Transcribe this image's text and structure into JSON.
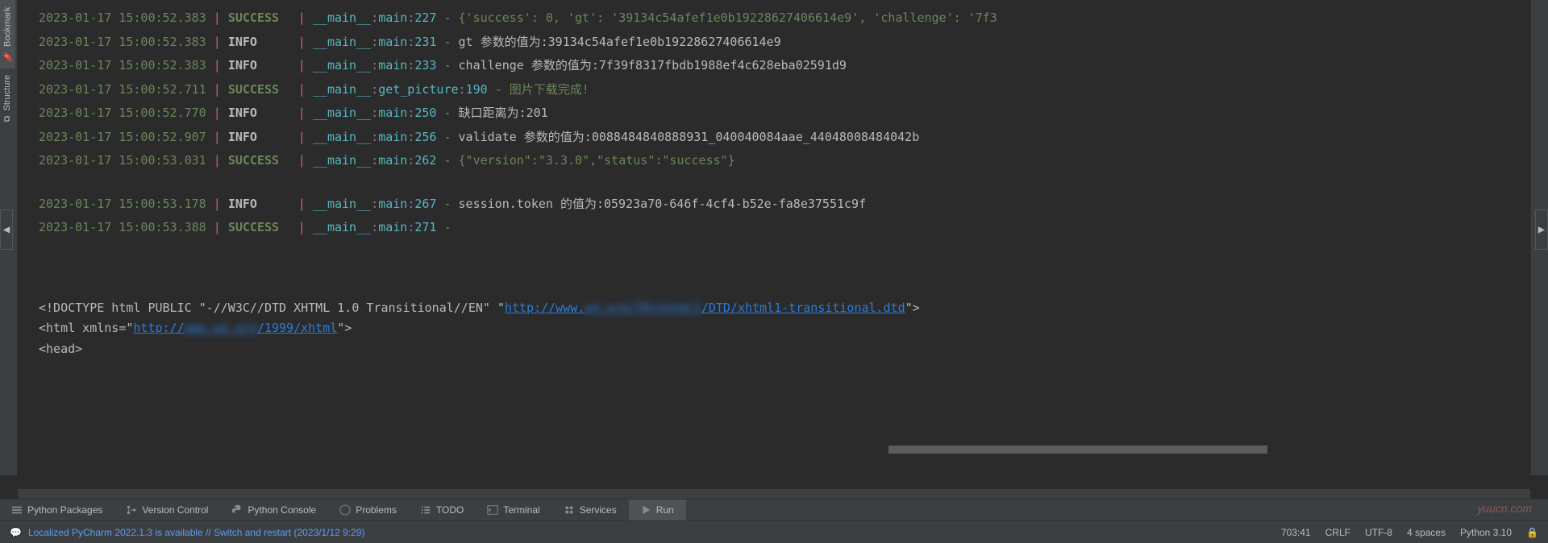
{
  "logs": [
    {
      "ts": "2023-01-17 15:00:52.383",
      "level": "SUCCESS",
      "module": "__main__",
      "func": "main",
      "line": "227",
      "msg_type": "green",
      "msg": "{'success': 0, 'gt': '39134c54afef1e0b19228627406614e9', 'challenge': '7f3"
    },
    {
      "ts": "2023-01-17 15:00:52.383",
      "level": "INFO",
      "module": "__main__",
      "func": "main",
      "line": "231",
      "msg_type": "gray",
      "msg": "gt 参数的值为:39134c54afef1e0b19228627406614e9"
    },
    {
      "ts": "2023-01-17 15:00:52.383",
      "level": "INFO",
      "module": "__main__",
      "func": "main",
      "line": "233",
      "msg_type": "gray",
      "msg": "challenge 参数的值为:7f39f8317fbdb1988ef4c628eba02591d9"
    },
    {
      "ts": "2023-01-17 15:00:52.711",
      "level": "SUCCESS",
      "module": "__main__",
      "func": "get_picture",
      "line": "190",
      "msg_type": "green",
      "msg": "图片下载完成!"
    },
    {
      "ts": "2023-01-17 15:00:52.770",
      "level": "INFO",
      "module": "__main__",
      "func": "main",
      "line": "250",
      "msg_type": "gray",
      "msg": "缺口距离为:201"
    },
    {
      "ts": "2023-01-17 15:00:52.907",
      "level": "INFO",
      "module": "__main__",
      "func": "main",
      "line": "256",
      "msg_type": "gray",
      "msg": "validate 参数的值为:0088484840888931_040040084aae_44048008484042b"
    },
    {
      "ts": "2023-01-17 15:00:53.031",
      "level": "SUCCESS",
      "module": "__main__",
      "func": "main",
      "line": "262",
      "msg_type": "green",
      "msg": "{\"version\":\"3.3.0\",\"status\":\"success\"}"
    },
    {
      "empty": true
    },
    {
      "ts": "2023-01-17 15:00:53.178",
      "level": "INFO",
      "module": "__main__",
      "func": "main",
      "line": "267",
      "msg_type": "gray",
      "msg": "session.token 的值为:05923a70-646f-4cf4-b52e-fa8e37551c9f"
    },
    {
      "ts": "2023-01-17 15:00:53.388",
      "level": "SUCCESS",
      "module": "__main__",
      "func": "main",
      "line": "271",
      "msg_type": "none",
      "msg": ""
    }
  ],
  "html_output": {
    "doctype_prefix": "<!DOCTYPE html PUBLIC \"-//W3C//DTD XHTML 1.0 Transitional//EN\" \"",
    "dtd_url_visible_1": "http://www.",
    "dtd_url_blur": "w3.org/TR/xhtml1",
    "dtd_url_visible_2": "/DTD/xhtml1-transitional.dtd",
    "doctype_suffix": "\">",
    "html_open_prefix": "<html xmlns=\"",
    "xmlns_visible_1": "http://",
    "xmlns_blur": "www.w3.org",
    "xmlns_visible_2": "/1999/xhtml",
    "html_open_suffix": "\">",
    "head_tag": "<head>"
  },
  "side_tabs": {
    "bookmark": "Bookmark",
    "structure": "Structure"
  },
  "bottom_tabs": [
    {
      "icon": "packages",
      "label": "Python Packages"
    },
    {
      "icon": "vcs",
      "label": "Version Control"
    },
    {
      "icon": "python",
      "label": "Python Console"
    },
    {
      "icon": "problems",
      "label": "Problems"
    },
    {
      "icon": "todo",
      "label": "TODO"
    },
    {
      "icon": "terminal",
      "label": "Terminal"
    },
    {
      "icon": "services",
      "label": "Services"
    },
    {
      "icon": "run",
      "label": "Run",
      "active": true
    }
  ],
  "status_bar": {
    "notification": "Localized PyCharm 2022.1.3 is available // Switch and restart (2023/1/12 9:29)",
    "position": "703:41",
    "line_sep": "CRLF",
    "encoding": "UTF-8",
    "indent": "4 spaces",
    "interpreter": "Python 3.10"
  },
  "watermark": "yuucn.com",
  "collapse_glyph_left": "◀",
  "collapse_glyph_right": "▶"
}
